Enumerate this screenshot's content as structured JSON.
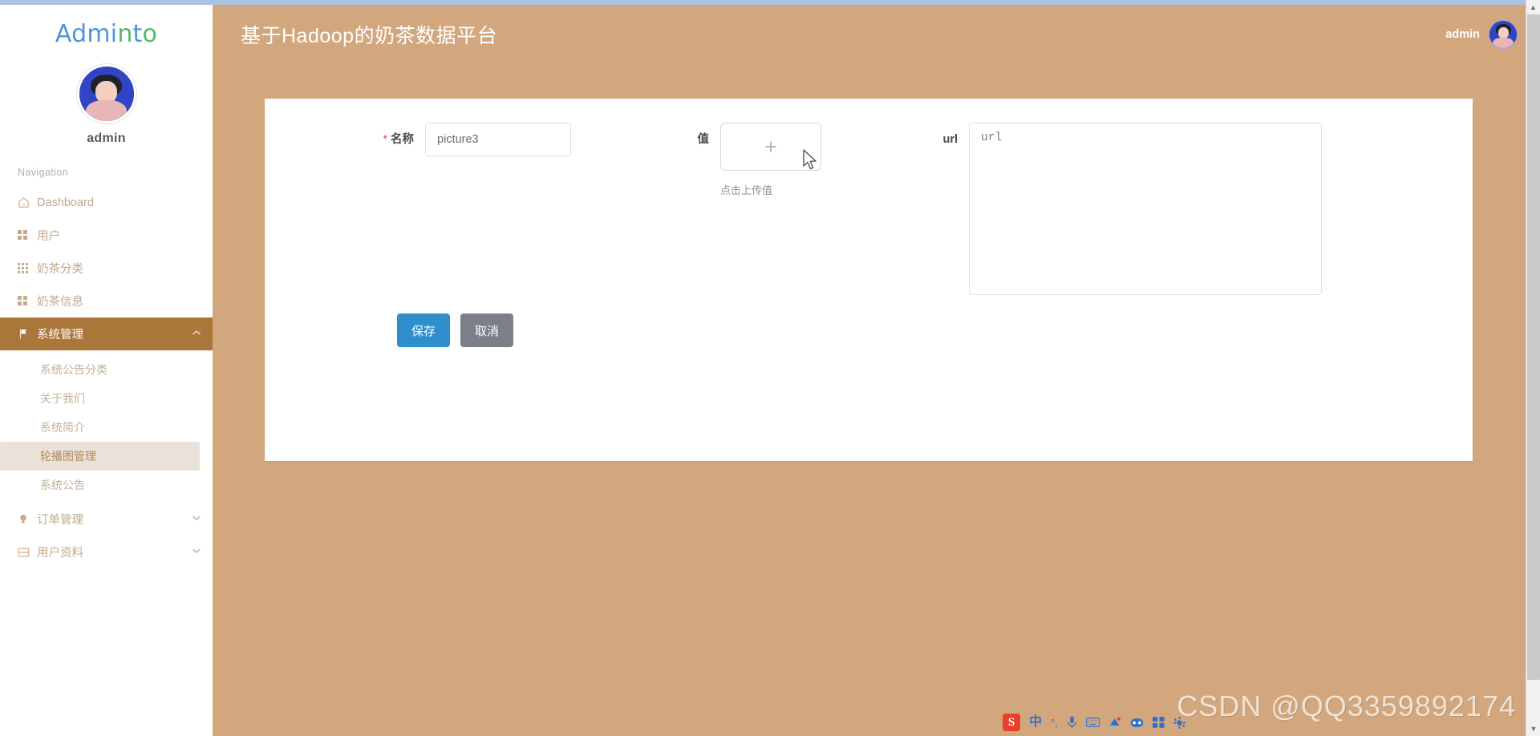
{
  "brand": {
    "part1": "Admi",
    "part2": "n",
    "part3": "t",
    "part4": "o"
  },
  "profile": {
    "username": "admin",
    "avatar_icon": "user-avatar"
  },
  "sidebar": {
    "nav_title": "Navigation",
    "items": [
      {
        "label": "Dashboard",
        "icon": "home-icon",
        "active": false,
        "chevron": ""
      },
      {
        "label": "用户",
        "icon": "grid-4-icon",
        "active": false,
        "chevron": ""
      },
      {
        "label": "奶茶分类",
        "icon": "grid-9-icon",
        "active": false,
        "chevron": ""
      },
      {
        "label": "奶茶信息",
        "icon": "grid-4-icon",
        "active": false,
        "chevron": ""
      },
      {
        "label": "系统管理",
        "icon": "flag-icon",
        "active": true,
        "chevron": "chevron-up-icon"
      }
    ],
    "sub_items": [
      {
        "label": "系统公告分类",
        "selected": false
      },
      {
        "label": "关于我们",
        "selected": false
      },
      {
        "label": "系统简介",
        "selected": false
      },
      {
        "label": "轮播图管理",
        "selected": true
      },
      {
        "label": "系统公告",
        "selected": false
      }
    ],
    "items_bottom": [
      {
        "label": "订单管理",
        "icon": "bulb-icon",
        "chevron": "chevron-down-icon"
      },
      {
        "label": "用户资料",
        "icon": "card-icon",
        "chevron": "chevron-down-icon"
      }
    ]
  },
  "header": {
    "title": "基于Hadoop的奶茶数据平台",
    "user": "admin",
    "avatar_icon": "user-avatar"
  },
  "form": {
    "name": {
      "label": "名称",
      "required_mark": "*",
      "value": "picture3",
      "placeholder": "名称"
    },
    "value": {
      "label": "值",
      "upload_icon": "plus-icon",
      "tip": "点击上传值"
    },
    "url": {
      "label": "url",
      "value": "",
      "placeholder": "url"
    },
    "buttons": {
      "save": "保存",
      "cancel": "取消"
    }
  },
  "scrollbar": {
    "up_arrow": "▲",
    "down_arrow": "▼"
  },
  "watermark": "CSDN @QQ3359892174",
  "ime": {
    "logo": "S",
    "items": [
      {
        "icon": "chinese-mode-icon",
        "glyph": "中"
      },
      {
        "icon": "punctuation-icon",
        "glyph": "°,"
      },
      {
        "icon": "microphone-icon",
        "glyph": "🎤"
      },
      {
        "icon": "keyboard-icon",
        "glyph": "⌨"
      },
      {
        "icon": "palette-icon",
        "glyph": "✲"
      },
      {
        "icon": "robot-icon",
        "glyph": "◉"
      },
      {
        "icon": "apps-icon",
        "glyph": "▦"
      },
      {
        "icon": "settings-icon",
        "glyph": "⚙"
      }
    ]
  },
  "colors": {
    "accent_brown": "#ab7639",
    "page_bg": "#d3a77d",
    "primary_button": "#2e8fcc",
    "default_button": "#7b8088",
    "required_red": "#c9525b"
  }
}
